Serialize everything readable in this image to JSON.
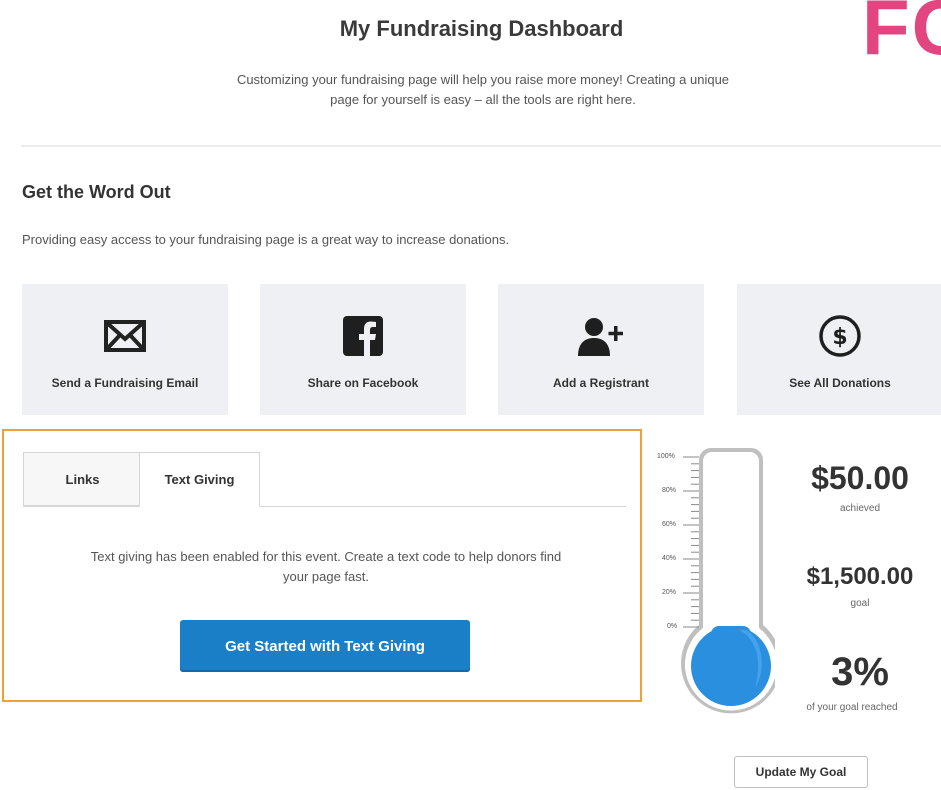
{
  "header": {
    "title": "My Fundraising Dashboard",
    "brand_fragment": "FC",
    "intro_line1": "Customizing your fundraising page will help you raise more money! Creating a unique",
    "intro_line2": "page for yourself is easy – all the tools are right here."
  },
  "word_out": {
    "heading": "Get the Word Out",
    "subheading": "Providing easy access to your fundraising page is a great way to increase donations.",
    "tiles": [
      {
        "label": "Send a Fundraising Email",
        "icon": "envelope-icon"
      },
      {
        "label": "Share on Facebook",
        "icon": "facebook-icon"
      },
      {
        "label": "Add a Registrant",
        "icon": "add-user-icon"
      },
      {
        "label": "See All Donations",
        "icon": "dollar-circle-icon"
      }
    ]
  },
  "tabs": {
    "items": [
      {
        "label": "Links",
        "active": false
      },
      {
        "label": "Text Giving",
        "active": true
      }
    ],
    "body_line1": "Text giving has been enabled for this event. Create a text code to help donors find",
    "body_line2": "your page fast.",
    "cta_label": "Get Started with Text Giving"
  },
  "thermometer": {
    "ticks": [
      "100%",
      "80%",
      "60%",
      "40%",
      "20%",
      "0%"
    ],
    "progress_percent": 3,
    "fill_color": "#2b8fe0"
  },
  "stats": {
    "achieved_value": "$50.00",
    "achieved_label": "achieved",
    "goal_value": "$1,500.00",
    "goal_label": "goal",
    "percent_value": "3%",
    "percent_label": "of your goal reached"
  },
  "actions": {
    "update_goal_label": "Update My Goal"
  },
  "colors": {
    "accent_blue": "#1b7fc7",
    "highlight_orange": "#f0a035",
    "brand_pink": "#e2457f",
    "tile_bg": "#eef0f3"
  }
}
